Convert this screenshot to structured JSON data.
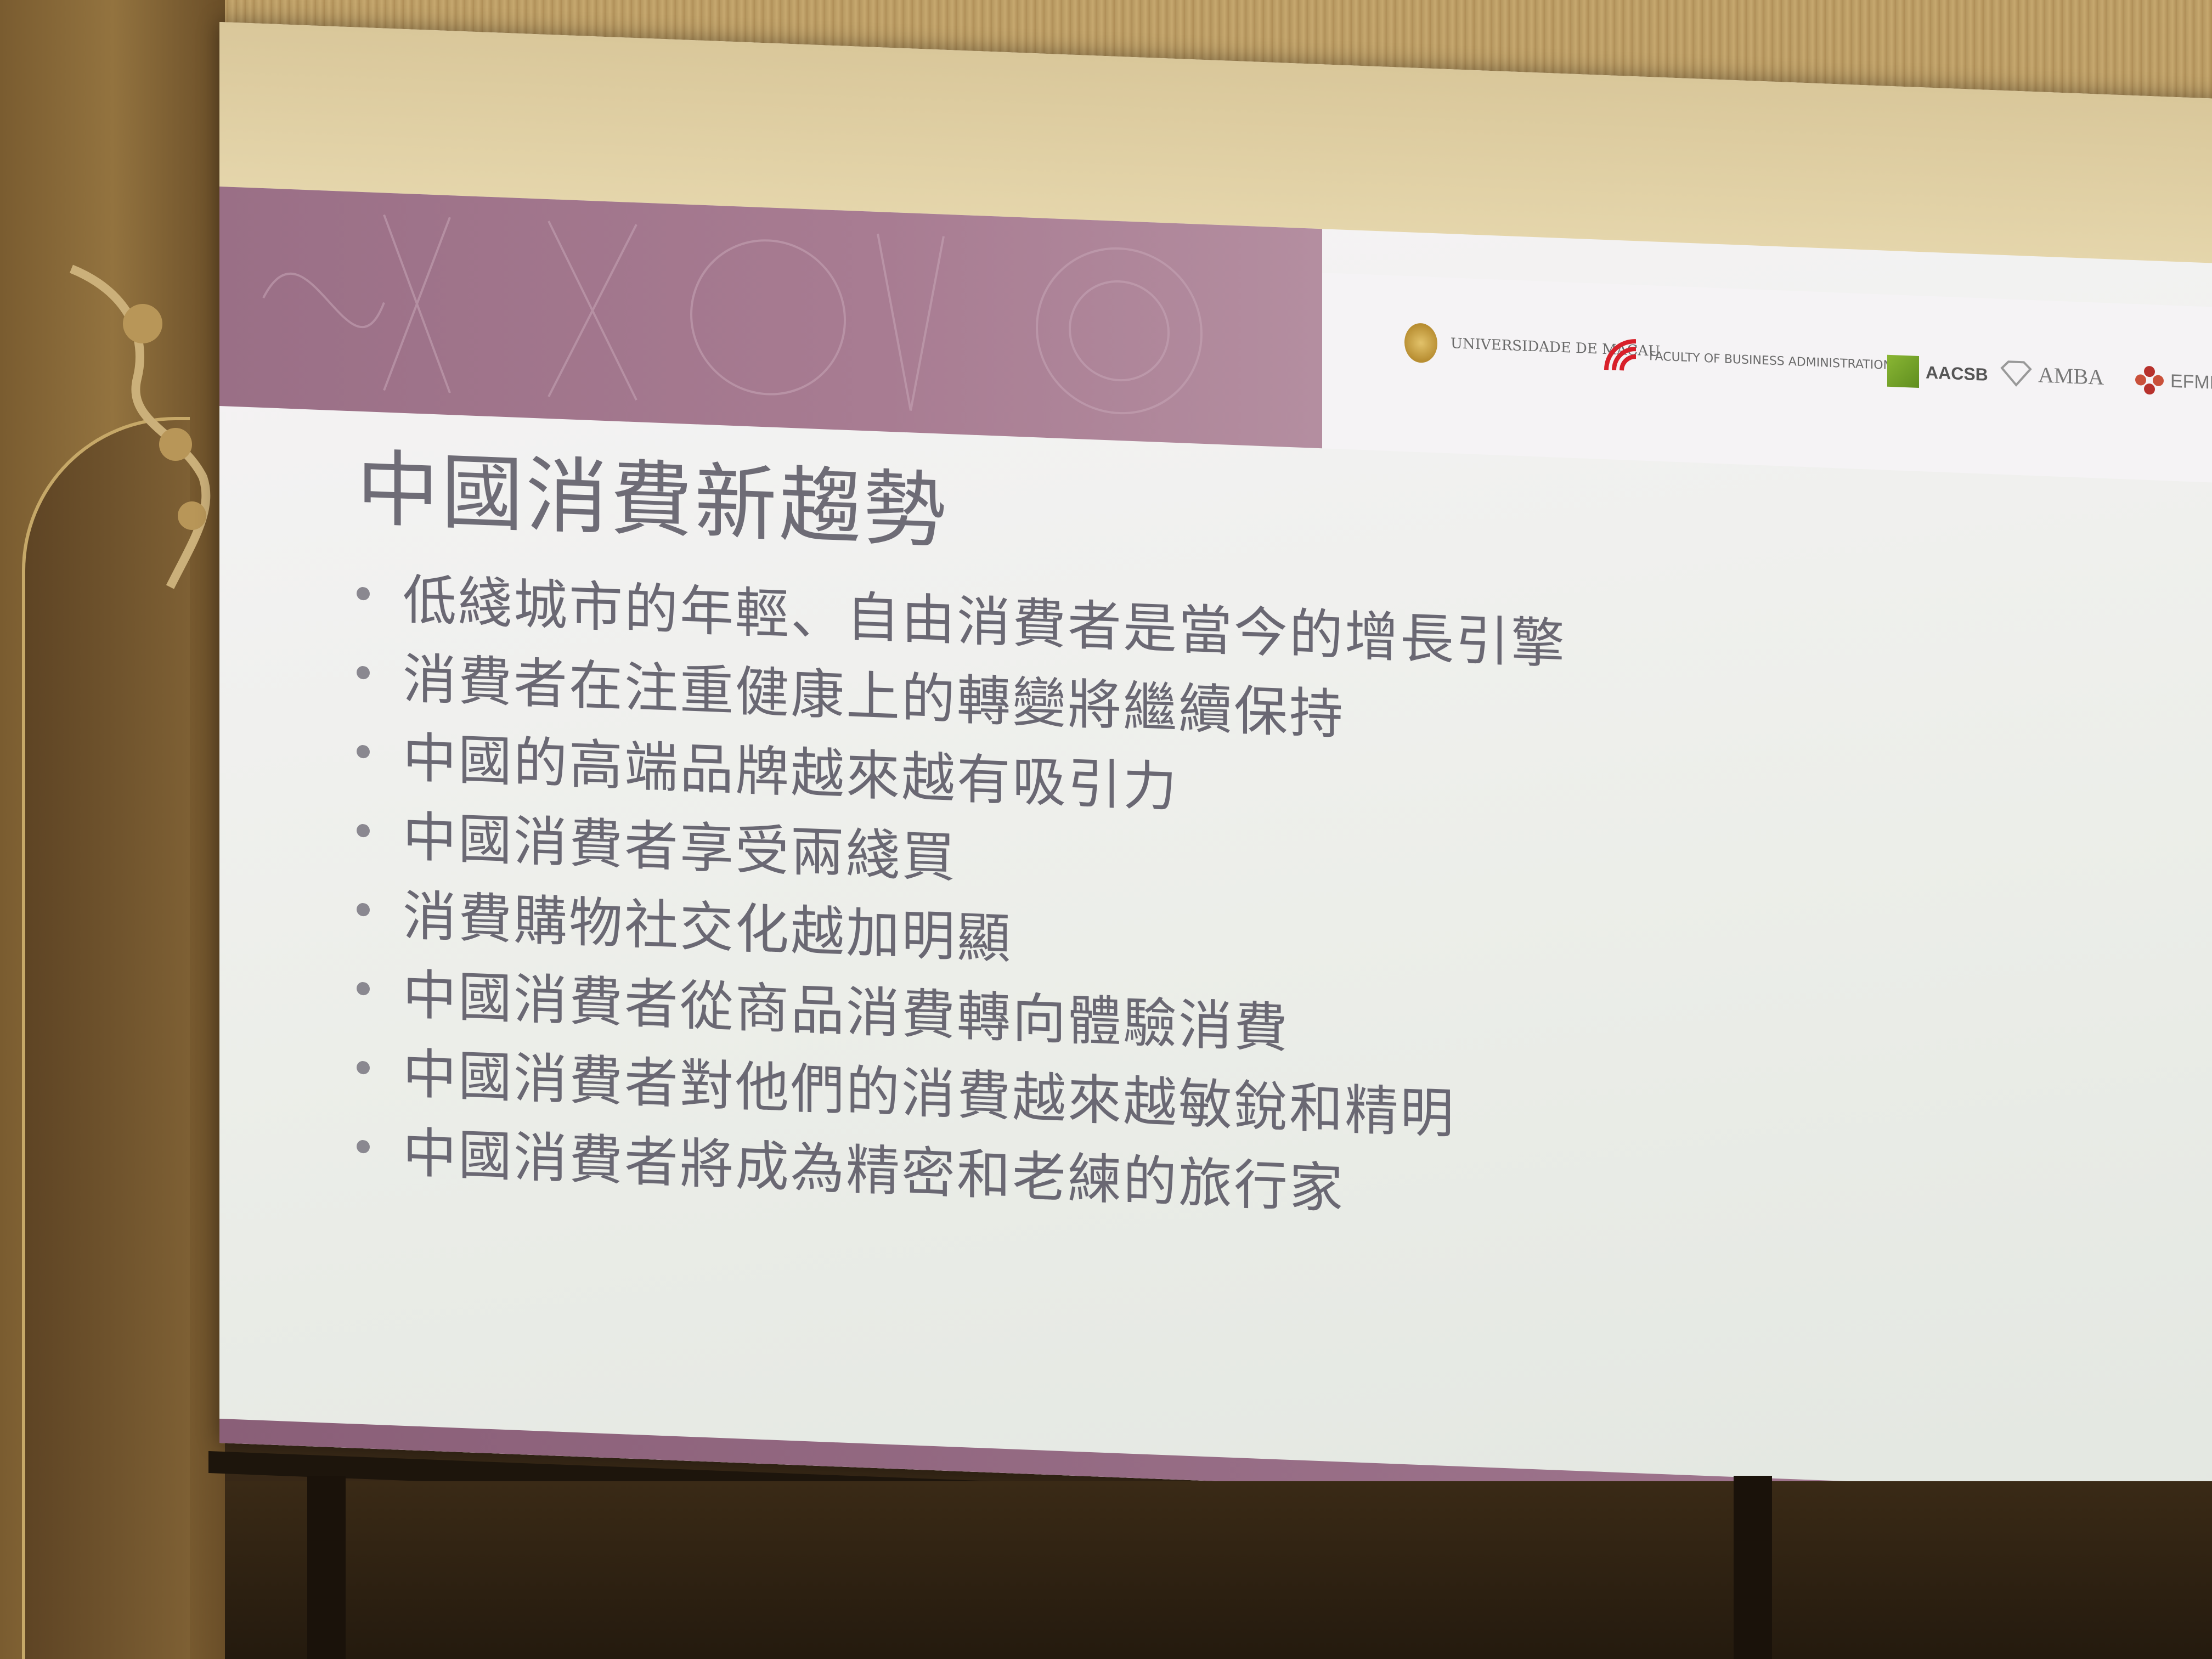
{
  "slide": {
    "title": "中國消費新趨勢",
    "bullets": [
      "低綫城市的年輕、自由消費者是當今的增長引擎",
      "消費者在注重健康上的轉變將繼續保持",
      "中國的高端品牌越來越有吸引力",
      "中國消費者享受兩綫買",
      "消費購物社交化越加明顯",
      "中國消費者從商品消費轉向體驗消費",
      "中國消費者對他們的消費越來越敏銳和精明",
      "中國消費者將成為精密和老練的旅行家"
    ],
    "logos": {
      "university": "UNIVERSIDADE DE MACAU",
      "faculty": "FACULTY OF BUSINESS ADMINISTRATION",
      "aacsb": "AACSB",
      "amba": "AMBA",
      "efmd": "EFMD"
    }
  },
  "colors": {
    "banner": "#a87c92",
    "slide_background": "#eceee9",
    "text": "#6a6873",
    "room": "#6e5430"
  }
}
